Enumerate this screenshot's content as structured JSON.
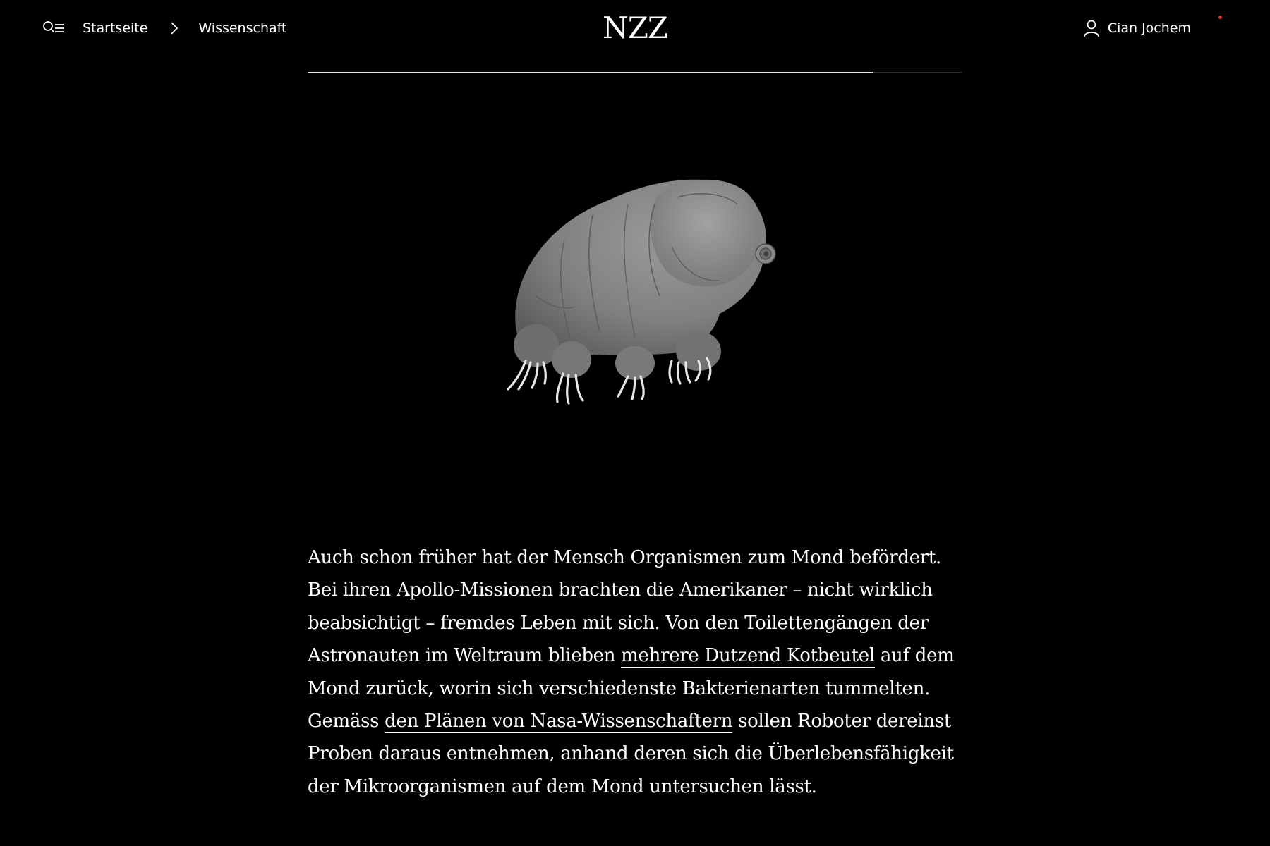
{
  "header": {
    "menu_icon": "menu-search-icon",
    "breadcrumb": {
      "home_label": "Startseite",
      "separator_icon": "chevron-right-icon",
      "section_label": "Wissenschaft"
    },
    "logo": "NZZ",
    "user": {
      "icon": "user-icon",
      "name": "Cian Jochem"
    },
    "notification_dot_color": "#e3342f"
  },
  "progress": {
    "fraction": 0.864
  },
  "illustration": {
    "icon": "tardigrade-illustration"
  },
  "article": {
    "paragraph": {
      "text_1": "Auch schon früher hat der Mensch Organismen zum Mond befördert. Bei ihren Apollo-Missionen brachten die Amerikaner – nicht wirklich beabsichtigt – fremdes Leben mit sich. Von den Toilettengängen der Astronauten im Weltraum blieben ",
      "link_1": "mehrere Dutzend Kotbeutel",
      "text_2": " auf dem Mond zurück, worin sich verschiedenste Bakterienarten tummelten. Gemäss ",
      "link_2": "den Plänen von Nasa-Wissenschaftern",
      "text_3": " sollen Roboter dereinst Proben daraus entnehmen, anhand deren sich die Überlebensfähigkeit der Mikroorganismen auf dem Mond untersuchen lässt."
    }
  },
  "colors": {
    "background": "#000000",
    "text": "#ffffff",
    "progress_fill": "#e9e9e9",
    "progress_track": "#2b2b2b"
  }
}
